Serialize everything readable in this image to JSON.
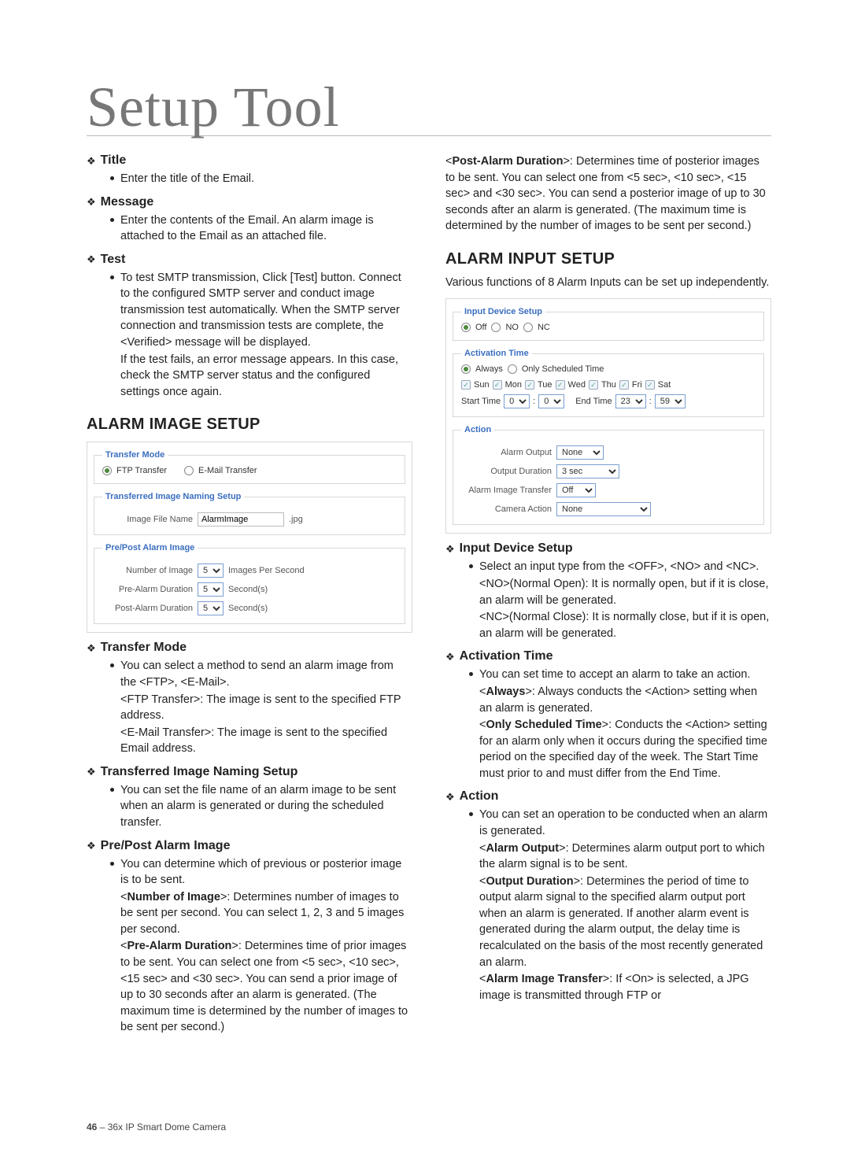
{
  "hero": "Setup Tool",
  "left": {
    "title": {
      "h": "Title",
      "bullet": "Enter the title of the Email."
    },
    "message": {
      "h": "Message",
      "bullet": "Enter the contents of the Email. An alarm image is attached to the Email as an attached file."
    },
    "test": {
      "h": "Test",
      "bullet": "To test SMTP transmission, Click [Test] button. Connect to the configured SMTP server and conduct image transmission test automatically. When the SMTP server connection and transmission tests are complete, the <Verified> message will be displayed.",
      "cont": "If the test fails, an error message appears. In this case, check the SMTP server status and the configured settings once again."
    },
    "sectionAlarmImage": "ALARM IMAGE SETUP",
    "panel1": {
      "lgdTransfer": "Transfer Mode",
      "radioFTP": "FTP Transfer",
      "radioEmail": "E-Mail Transfer",
      "lgdNaming": "Transferred Image Naming Setup",
      "lblImageFile": "Image File Name",
      "valImageFile": "AlarmImage",
      "ext": ".jpg",
      "lgdPrePost": "Pre/Post Alarm Image",
      "lblNum": "Number of Image",
      "valNum": "5",
      "unitNum": "Images Per Second",
      "lblPre": "Pre-Alarm Duration",
      "valPre": "5",
      "unitSec": "Second(s)",
      "lblPost": "Post-Alarm Duration",
      "valPost": "5"
    },
    "tm": {
      "h": "Transfer Mode",
      "bullet": "You can select a method to send an alarm image from the <FTP>, <E-Mail>.",
      "c1a": "<FTP Transfer>: The image is sent to the specified FTP address.",
      "c1b": "<E-Mail Transfer>: The image is sent to the specified Email address."
    },
    "tins": {
      "h": "Transferred Image Naming Setup",
      "bullet": "You can set the file name of an alarm image to be sent when an alarm is generated or during the scheduled transfer."
    },
    "ppai": {
      "h": "Pre/Post Alarm Image",
      "bullet": "You can determine which of previous or posterior image is to be sent.",
      "c_num_lead": "Number of Image",
      "c_num_rest": ">: Determines number of images to be sent per second. You can select 1, 2, 3 and 5 images per second.",
      "c_pre_lead": "Pre-Alarm Duration",
      "c_pre_rest": ">: Determines time of prior images to be sent. You can select one from <5 sec>, <10 sec>, <15 sec> and <30 sec>. You can send a prior image of up to 30 seconds after an alarm is generated. (The maximum time is determined by the number of images to be sent per second.)"
    }
  },
  "right": {
    "post_lead": "Post-Alarm Duration",
    "post_rest": ">: Determines time of posterior images to be sent. You can select one from <5 sec>, <10 sec>, <15 sec> and <30 sec>. You can send a posterior image of up to 30 seconds after an alarm is generated. (The maximum time is determined by the number of images to be sent per second.)",
    "sectionAlarmInput": "ALARM INPUT SETUP",
    "intro": "Various functions of 8 Alarm Inputs can be set up independently.",
    "panel2": {
      "lgdInput": "Input Device Setup",
      "rOff": "Off",
      "rNO": "NO",
      "rNC": "NC",
      "lgdAct": "Activation Time",
      "rAlways": "Always",
      "rSched": "Only Scheduled Time",
      "days": {
        "sun": "Sun",
        "mon": "Mon",
        "tue": "Tue",
        "wed": "Wed",
        "thu": "Thu",
        "fri": "Fri",
        "sat": "Sat"
      },
      "lblStart": "Start Time",
      "sH": "0",
      "sM": "0",
      "lblEnd": "End Time",
      "eH": "23",
      "eM": "59",
      "lgdAction": "Action",
      "lblAO": "Alarm Output",
      "valAO": "None",
      "lblOD": "Output Duration",
      "valOD": "3 sec",
      "lblAIT": "Alarm Image Transfer",
      "valAIT": "Off",
      "lblCA": "Camera Action",
      "valCA": "None"
    },
    "ids": {
      "h": "Input Device Setup",
      "bullet": "Select an input type from the <OFF>, <NO> and <NC>.",
      "c1": "<NO>(Normal Open): It is normally open, but if it is close, an alarm will be generated.",
      "c2": "<NC>(Normal Close): It is normally close, but if it is open, an alarm will be generated."
    },
    "at": {
      "h": "Activation Time",
      "bullet": "You can set time to accept an alarm to take an action.",
      "c1_lead": "Always",
      "c1_rest": ">: Always conducts the <Action> setting when an alarm is generated.",
      "c2_lead": "Only Scheduled Time",
      "c2_rest": ">: Conducts the <Action> setting for an alarm only when it occurs during the specified time period on the specified day of the week. The Start Time must prior to and must differ from the End Time."
    },
    "action": {
      "h": "Action",
      "bullet": "You can set an operation to be conducted when an alarm is generated.",
      "c1_lead": "Alarm Output",
      "c1_rest": ">: Determines alarm output port to which the alarm signal is to be sent.",
      "c2_lead": "Output Duration",
      "c2_rest": ">: Determines the period of time to output alarm signal to the specified alarm output port when an alarm is generated. If another alarm event is generated during the alarm output, the delay time is recalculated on the basis of the most recently generated an alarm.",
      "c3_lead": "Alarm Image Transfer",
      "c3_rest": ">: If <On> is selected, a JPG image is transmitted through FTP or"
    }
  },
  "footer": {
    "page": "46",
    "sep": " – ",
    "product": "36x IP Smart Dome Camera"
  }
}
